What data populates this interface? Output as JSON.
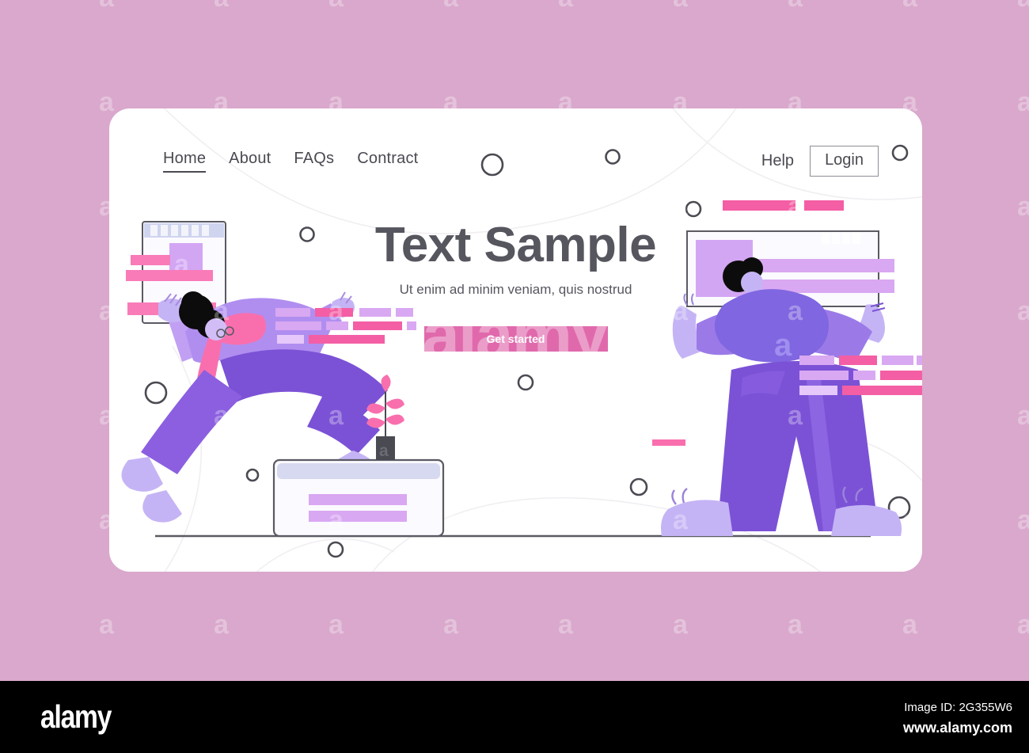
{
  "background": {
    "color": "#d9a8cc",
    "watermark_letter": "a",
    "watermark_word": "alamy"
  },
  "card": {
    "background": "#ffffff"
  },
  "nav": {
    "links": [
      {
        "label": "Home",
        "active": true
      },
      {
        "label": "About",
        "active": false
      },
      {
        "label": "FAQs",
        "active": false
      },
      {
        "label": "Contract",
        "active": false
      }
    ],
    "help_label": "Help",
    "login_label": "Login"
  },
  "hero": {
    "headline": "Text Sample",
    "subheadline": "Ut enim ad minim veniam, quis nostrud",
    "cta_label": "Get started"
  },
  "colors": {
    "accent_pink": "#e069ac",
    "bar_pink": "#f97bb8",
    "bar_lilac": "#d9a8f2",
    "pants_purple": "#7b52d6",
    "shirt_lilac": "#b08ef0",
    "shoe_lilac": "#c5b4f5",
    "text_gray": "#56565f",
    "hair_black": "#0c0c0c"
  },
  "footer": {
    "logo": "alamy",
    "image_id_label": "Image ID: 2G355W6",
    "url": "www.alamy.com"
  }
}
